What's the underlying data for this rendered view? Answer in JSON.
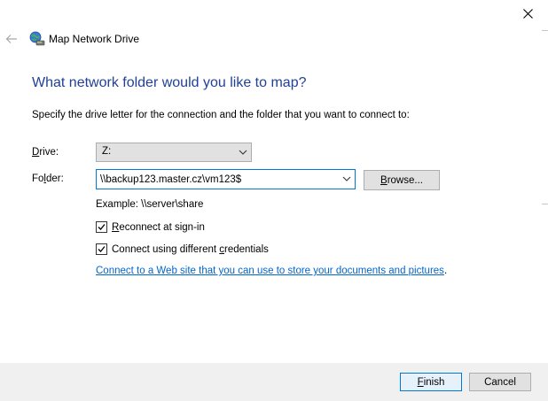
{
  "window": {
    "title": "Map Network Drive",
    "close_icon": "close-icon",
    "back_icon": "back-arrow-icon",
    "app_icon": "network-drive-icon"
  },
  "main": {
    "heading": "What network folder would you like to map?",
    "instruction": "Specify the drive letter for the connection and the folder that you want to connect to:"
  },
  "drive": {
    "label_accel": "D",
    "label_rest": "rive:",
    "value": "Z:"
  },
  "folder": {
    "label_pre": "Fo",
    "label_accel": "l",
    "label_rest": "der:",
    "value": "\\\\backup123.master.cz\\vm123$",
    "browse_accel": "B",
    "browse_rest": "rowse..."
  },
  "example": "Example: \\\\server\\share",
  "options": {
    "reconnect_accel": "R",
    "reconnect_rest": "econnect at sign-in",
    "reconnect_checked": true,
    "credentials_pre": "Connect using different ",
    "credentials_accel": "c",
    "credentials_rest": "redentials",
    "credentials_checked": true
  },
  "link": {
    "text": "Connect to a Web site that you can use to store your documents and pictures",
    "suffix": "."
  },
  "footer": {
    "finish_accel": "F",
    "finish_rest": "inish",
    "cancel_label": "Cancel"
  },
  "colors": {
    "heading": "#21409a",
    "link": "#0066cc",
    "footer_bg": "#f0f0f0",
    "focus_border": "#0078d7"
  }
}
